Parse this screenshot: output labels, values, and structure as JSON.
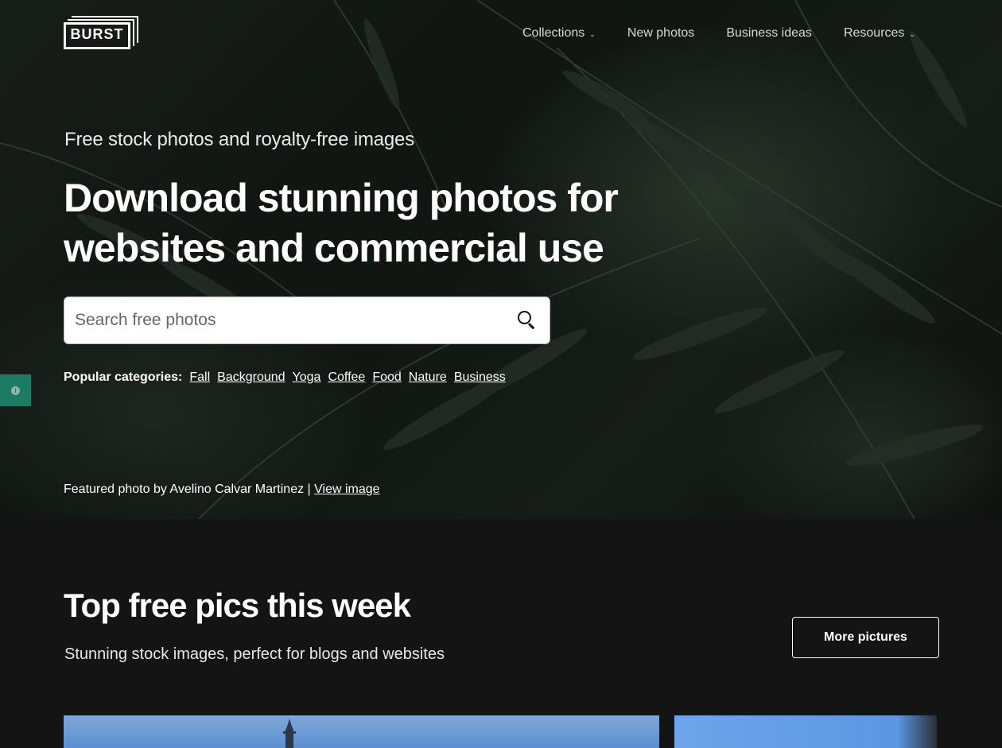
{
  "logo": {
    "text": "BURST"
  },
  "nav": {
    "items": [
      {
        "label": "Collections",
        "has_dropdown": true
      },
      {
        "label": "New photos",
        "has_dropdown": false
      },
      {
        "label": "Business ideas",
        "has_dropdown": false
      },
      {
        "label": "Resources",
        "has_dropdown": true
      }
    ]
  },
  "hero": {
    "tagline": "Free stock photos and royalty-free images",
    "headline": "Download stunning photos for websites and commercial use",
    "search": {
      "placeholder": "Search free photos",
      "value": ""
    },
    "popular": {
      "label": "Popular categories:",
      "categories": [
        "Fall",
        "Background",
        "Yoga",
        "Coffee",
        "Food",
        "Nature",
        "Business"
      ]
    },
    "credit": {
      "text": "Featured photo by Avelino Calvar Martinez |",
      "link": "View image"
    }
  },
  "section": {
    "title": "Top free pics this week",
    "subtitle": "Stunning stock images, perfect for blogs and websites",
    "button": "More pictures"
  },
  "colors": {
    "page_bg": "#141414",
    "info_tab": "#1d7b63",
    "text": "#ffffff"
  },
  "icons": {
    "search": "search-icon",
    "dropdown": "chevron-down-icon",
    "info": "info-icon"
  }
}
